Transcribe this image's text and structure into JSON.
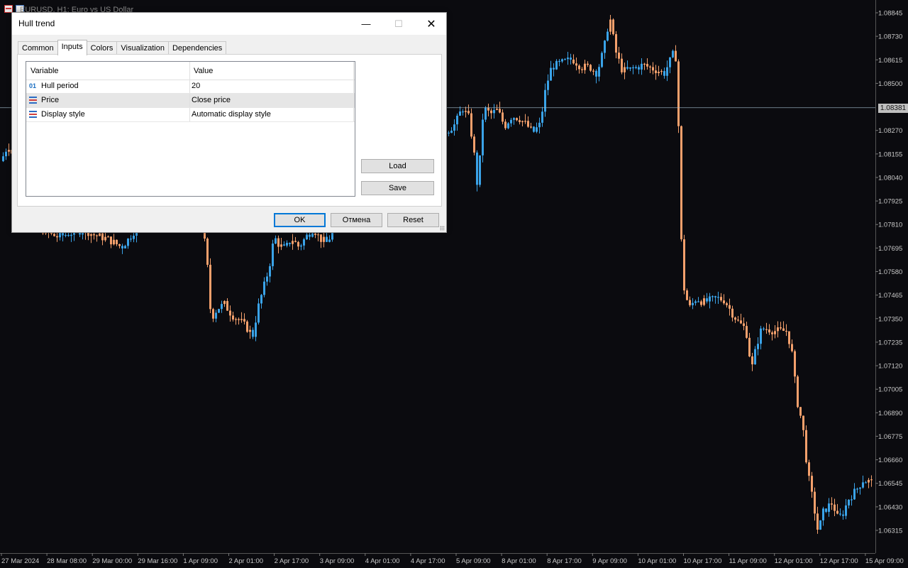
{
  "chart": {
    "title": "EURUSD, H1:  Euro vs US Dollar",
    "current_price": "1.08381",
    "colors": {
      "background": "#0b0b0f",
      "bull": "#3aa3e8",
      "bear": "#f4a06c",
      "axis_text": "#c8c8c8",
      "crosshair": "#9fb9c8"
    }
  },
  "chart_data": {
    "type": "candlestick",
    "price_axis": [
      "1.08845",
      "1.08730",
      "1.08615",
      "1.08500",
      "1.08270",
      "1.08155",
      "1.08040",
      "1.07925",
      "1.07810",
      "1.07695",
      "1.07580",
      "1.07465",
      "1.07350",
      "1.07235",
      "1.07120",
      "1.07005",
      "1.06890",
      "1.06775",
      "1.06660",
      "1.06545",
      "1.06430",
      "1.06315"
    ],
    "time_axis": [
      "27 Mar 2024",
      "28 Mar 08:00",
      "29 Mar 00:00",
      "29 Mar 16:00",
      "1 Apr 09:00",
      "2 Apr 01:00",
      "2 Apr 17:00",
      "3 Apr 09:00",
      "4 Apr 01:00",
      "4 Apr 17:00",
      "5 Apr 09:00",
      "8 Apr 01:00",
      "8 Apr 17:00",
      "9 Apr 09:00",
      "10 Apr 01:00",
      "10 Apr 17:00",
      "11 Apr 09:00",
      "12 Apr 01:00",
      "12 Apr 17:00",
      "15 Apr 09:00"
    ],
    "ylim": [
      1.0625,
      1.089
    ],
    "close_path": [
      [
        0,
        1.0812
      ],
      [
        10,
        1.082
      ],
      [
        20,
        1.0812
      ],
      [
        30,
        1.08
      ],
      [
        40,
        1.079
      ],
      [
        50,
        1.0782
      ],
      [
        60,
        1.0778
      ],
      [
        70,
        1.0776
      ],
      [
        80,
        1.0775
      ],
      [
        90,
        1.0776
      ],
      [
        100,
        1.0777
      ],
      [
        110,
        1.0778
      ],
      [
        120,
        1.0778
      ],
      [
        130,
        1.0776
      ],
      [
        140,
        1.0775
      ],
      [
        150,
        1.0774
      ],
      [
        160,
        1.0772
      ],
      [
        170,
        1.077
      ],
      [
        180,
        1.0774
      ],
      [
        190,
        1.0779
      ],
      [
        200,
        1.0781
      ],
      [
        210,
        1.0783
      ],
      [
        220,
        1.0784
      ],
      [
        230,
        1.0784
      ],
      [
        240,
        1.0786
      ],
      [
        250,
        1.079
      ],
      [
        260,
        1.0795
      ],
      [
        270,
        1.0797
      ],
      [
        280,
        1.079
      ],
      [
        290,
        1.0765
      ],
      [
        296,
        1.0735
      ],
      [
        305,
        1.074
      ],
      [
        315,
        1.0742
      ],
      [
        325,
        1.0737
      ],
      [
        340,
        1.0733
      ],
      [
        355,
        1.0727
      ],
      [
        362,
        1.074
      ],
      [
        370,
        1.075
      ],
      [
        378,
        1.076
      ],
      [
        385,
        1.0775
      ],
      [
        392,
        1.0771
      ],
      [
        400,
        1.0769
      ],
      [
        410,
        1.0774
      ],
      [
        420,
        1.077
      ],
      [
        430,
        1.0775
      ],
      [
        440,
        1.0779
      ],
      [
        450,
        1.0774
      ],
      [
        460,
        1.0772
      ],
      [
        470,
        1.078
      ],
      [
        480,
        1.0788
      ],
      [
        490,
        1.0795
      ],
      [
        500,
        1.08
      ],
      [
        510,
        1.0805
      ],
      [
        520,
        1.0808
      ],
      [
        530,
        1.0812
      ],
      [
        540,
        1.0816
      ],
      [
        550,
        1.082
      ],
      [
        560,
        1.0823
      ],
      [
        570,
        1.0825
      ],
      [
        580,
        1.0826
      ],
      [
        590,
        1.0826
      ],
      [
        600,
        1.0826
      ],
      [
        610,
        1.0826
      ],
      [
        620,
        1.0827
      ],
      [
        630,
        1.0827
      ],
      [
        640,
        1.083
      ],
      [
        650,
        1.0838
      ],
      [
        660,
        1.0833
      ],
      [
        667,
        1.0815
      ],
      [
        672,
        1.0798
      ],
      [
        680,
        1.0838
      ],
      [
        690,
        1.0835
      ],
      [
        700,
        1.0837
      ],
      [
        710,
        1.0829
      ],
      [
        720,
        1.0834
      ],
      [
        730,
        1.0833
      ],
      [
        740,
        1.083
      ],
      [
        750,
        1.0826
      ],
      [
        760,
        1.083
      ],
      [
        768,
        1.0848
      ],
      [
        776,
        1.0858
      ],
      [
        790,
        1.086
      ],
      [
        805,
        1.0862
      ],
      [
        818,
        1.0858
      ],
      [
        830,
        1.0858
      ],
      [
        840,
        1.0855
      ],
      [
        850,
        1.0867
      ],
      [
        858,
        1.0883
      ],
      [
        866,
        1.0866
      ],
      [
        876,
        1.0856
      ],
      [
        890,
        1.0857
      ],
      [
        905,
        1.0859
      ],
      [
        920,
        1.0857
      ],
      [
        935,
        1.0855
      ],
      [
        947,
        1.0864
      ],
      [
        953,
        1.0862
      ],
      [
        958,
        1.078
      ],
      [
        962,
        1.0751
      ],
      [
        970,
        1.074
      ],
      [
        980,
        1.0745
      ],
      [
        990,
        1.0743
      ],
      [
        1000,
        1.0744
      ],
      [
        1010,
        1.0745
      ],
      [
        1020,
        1.0744
      ],
      [
        1030,
        1.0738
      ],
      [
        1040,
        1.0733
      ],
      [
        1050,
        1.073
      ],
      [
        1058,
        1.071
      ],
      [
        1065,
        1.0722
      ],
      [
        1072,
        1.073
      ],
      [
        1080,
        1.073
      ],
      [
        1090,
        1.0729
      ],
      [
        1100,
        1.0729
      ],
      [
        1108,
        1.0729
      ],
      [
        1115,
        1.0718
      ],
      [
        1122,
        1.0695
      ],
      [
        1130,
        1.0683
      ],
      [
        1137,
        1.066
      ],
      [
        1145,
        1.0645
      ],
      [
        1152,
        1.063
      ],
      [
        1158,
        1.064
      ],
      [
        1165,
        1.0643
      ],
      [
        1172,
        1.0645
      ],
      [
        1180,
        1.0637
      ],
      [
        1187,
        1.064
      ],
      [
        1195,
        1.0647
      ],
      [
        1205,
        1.0651
      ],
      [
        1215,
        1.0656
      ],
      [
        1230,
        1.0655
      ]
    ]
  },
  "dialog": {
    "title": "Hull trend",
    "window_controls": {
      "minimize": "—",
      "maximize": "☐",
      "close": "✕"
    },
    "tabs": [
      "Common",
      "Inputs",
      "Colors",
      "Visualization",
      "Dependencies"
    ],
    "active_tab": "Inputs",
    "grid": {
      "columns": [
        "Variable",
        "Value"
      ],
      "rows": [
        {
          "icon": "int-icon",
          "icon_text": "01",
          "variable": "Hull period",
          "value": "20"
        },
        {
          "icon": "list-icon",
          "variable": "Price",
          "value": "Close price"
        },
        {
          "icon": "list-icon",
          "variable": "Display style",
          "value": "Automatic display style"
        }
      ]
    },
    "side_buttons": {
      "load": "Load",
      "save": "Save"
    },
    "footer_buttons": {
      "ok": "OK",
      "cancel": "Отмена",
      "reset": "Reset"
    }
  }
}
